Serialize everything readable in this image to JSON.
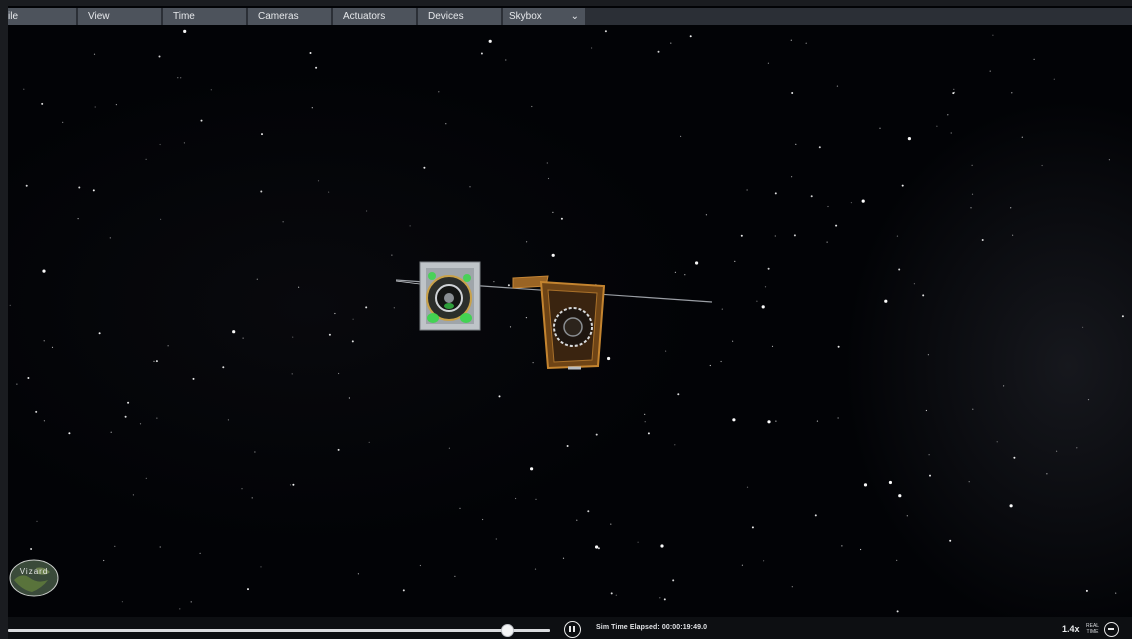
{
  "menu": {
    "items": [
      {
        "label": "ile"
      },
      {
        "label": "View"
      },
      {
        "label": "Time"
      },
      {
        "label": "Cameras"
      },
      {
        "label": "Actuators"
      },
      {
        "label": "Devices"
      }
    ],
    "skybox_label": "Skybox"
  },
  "logo": {
    "text": "Vizard"
  },
  "playback": {
    "position_fraction": 0.92,
    "sim_time_text": "Sim Time Elapsed: 00:00:19:49.0",
    "speed": "1.4x",
    "realtime_label": "REAL\nTIME"
  },
  "icons": {
    "pause": "pause-icon",
    "speed_down": "minus-circle-icon",
    "skybox_dropdown": "chevron-down-icon"
  },
  "colors": {
    "menu_bg": "#4d535c",
    "space_bg": "#020306",
    "spacecraft_green_glow": "#39d84a",
    "spacecraft_orange": "#b8782a"
  }
}
